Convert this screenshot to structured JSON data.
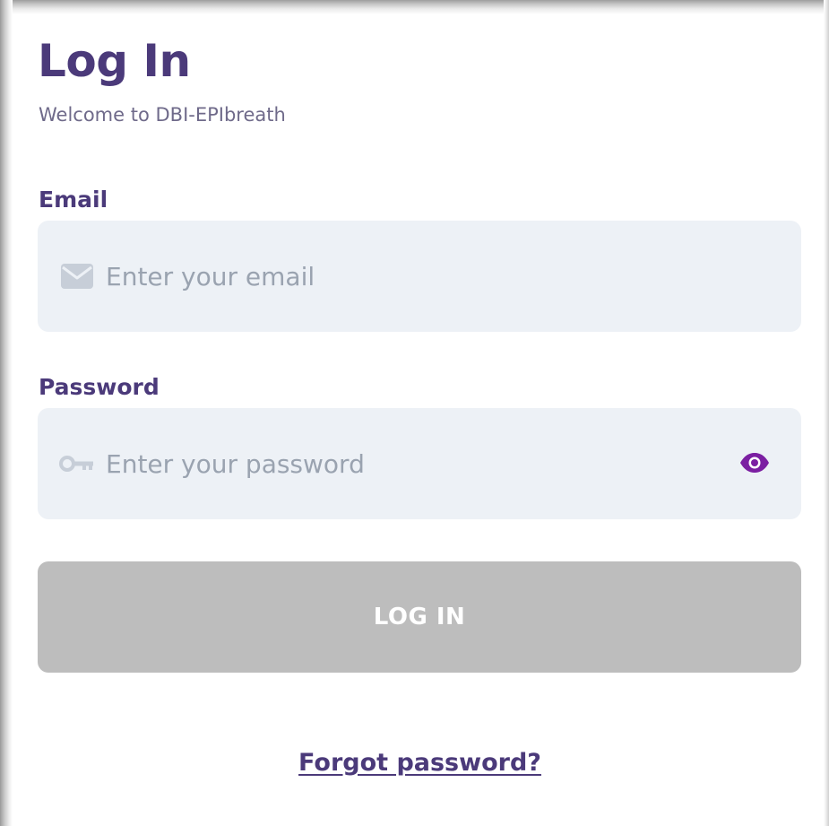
{
  "header": {
    "title": "Log In",
    "subtitle": "Welcome to DBI-EPIbreath"
  },
  "form": {
    "email": {
      "label": "Email",
      "value": "",
      "placeholder": "Enter your email",
      "icon": "envelope-icon"
    },
    "password": {
      "label": "Password",
      "value": "",
      "placeholder": "Enter your password",
      "icon": "key-icon",
      "toggle_icon": "eye-icon"
    },
    "submit_label": "LOG IN",
    "forgot_label": "Forgot password?"
  },
  "colors": {
    "heading": "#4b3a7a",
    "subtitle": "#6f6a8a",
    "input_background": "#edf1f6",
    "placeholder": "#9aa3b0",
    "input_icon": "#c7ced8",
    "eye_icon": "#7b1fa2",
    "button_disabled": "#bdbdbd",
    "button_text": "#ffffff"
  }
}
